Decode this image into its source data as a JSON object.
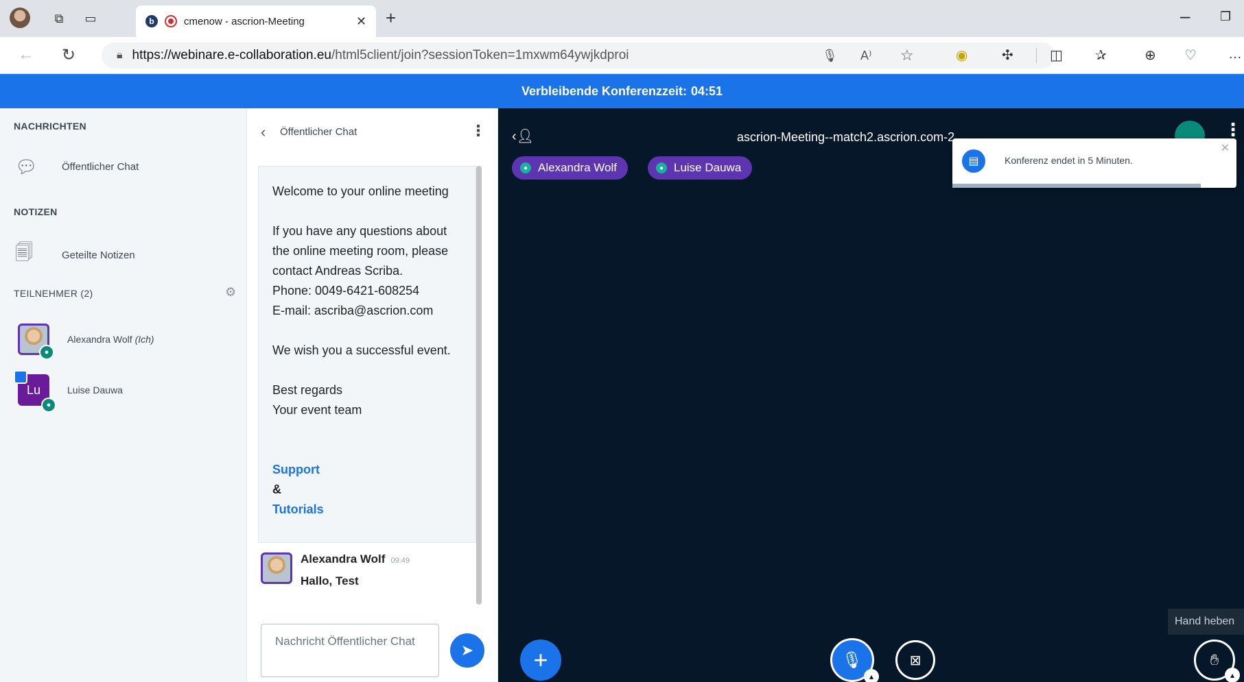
{
  "browser": {
    "tab_title": "cmenow - ascrion-Meeting",
    "tab_fav": "b",
    "url_host": "https://webinare.e-collaboration.eu",
    "url_path": "/html5client/join?sessionToken=1mxwm64ywjkdproi",
    "read_aloud": "A⁾"
  },
  "banner": {
    "label": "Verbleibende Konferenzzeit:",
    "time": "04:51"
  },
  "sidebar": {
    "messages_header": "NACHRICHTEN",
    "public_chat": "Öffentlicher Chat",
    "notes_header": "NOTIZEN",
    "shared_notes": "Geteilte Notizen",
    "participants_header": "TEILNEHMER (2)",
    "users": [
      {
        "name": "Alexandra Wolf",
        "suffix": "(Ich)"
      },
      {
        "name": "Luise Dauwa",
        "initials": "Lu"
      }
    ]
  },
  "chat": {
    "title": "Öffentlicher Chat",
    "welcome": {
      "line1": "Welcome to your online meeting",
      "para2": "If you have any questions about the online meeting room, please contact Andreas Scriba.\nPhone: 0049-6421-608254\nE-mail: ascriba@ascrion.com",
      "para3": "We wish you a successful event.",
      "para4": "Best regards\nYour event team",
      "support": "Support",
      "amp": "&",
      "tutorials": "Tutorials"
    },
    "message": {
      "author": "Alexandra Wolf",
      "time": "09:49",
      "text": "Hallo, Test"
    },
    "input_placeholder": "Nachricht Öffentlicher Chat"
  },
  "main": {
    "meeting_title": "ascrion-Meeting--match2.ascrion.com-2",
    "talkers": [
      "Alexandra Wolf",
      "Luise Dauwa"
    ],
    "toast": "Konferenz endet in 5 Minuten.",
    "hand_tooltip": "Hand heben"
  }
}
